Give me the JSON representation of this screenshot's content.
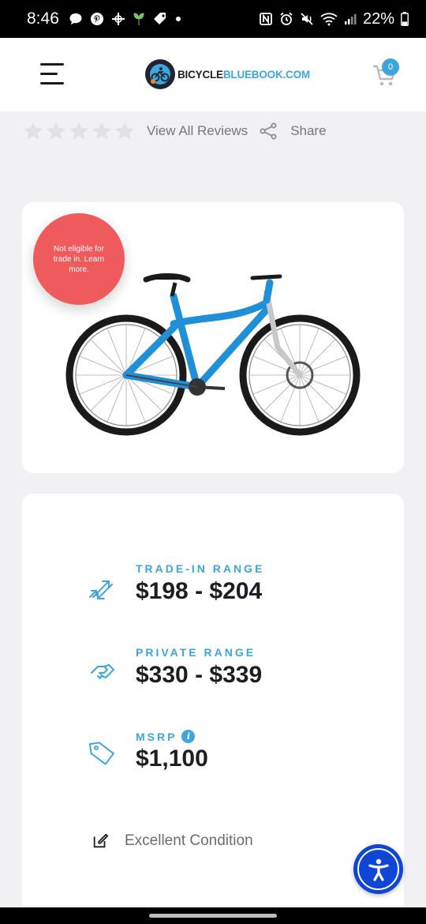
{
  "status_bar": {
    "time": "8:46",
    "battery": "22%",
    "left_icons": [
      "chat-icon",
      "pinterest-icon",
      "game-controller-icon",
      "plant-icon",
      "tag-icon",
      "dot-icon"
    ],
    "right_icons": [
      "nfc-icon",
      "alarm-icon",
      "mute-icon",
      "wifi-icon",
      "signal-icon",
      "battery-icon"
    ]
  },
  "header": {
    "logo_text_main": "BICYCLE",
    "logo_text_accent": "BLUEBOOK.COM",
    "cart_count": "0",
    "brand_color": "#3ca6dd"
  },
  "reviews": {
    "star_count": 5,
    "rating": 0,
    "view_all_label": "View All Reviews",
    "share_label": "Share"
  },
  "image_card": {
    "badge_text": "Not eligible for trade in. Learn more.",
    "badge_color": "#ef5a5d",
    "bike_color": "#1f8fd8"
  },
  "prices": {
    "trade_in": {
      "label": "TRADE-IN RANGE",
      "value": "$198 - $204",
      "icon": "trade-arrows-icon"
    },
    "private": {
      "label": "PRIVATE RANGE",
      "value": "$330 - $339",
      "icon": "handshake-icon"
    },
    "msrp": {
      "label": "MSRP",
      "value": "$1,100",
      "icon": "price-tag-icon",
      "info_glyph": "i"
    }
  },
  "condition": {
    "label": "Excellent Condition",
    "icon": "edit-icon"
  },
  "accessibility": {
    "icon": "accessibility-icon",
    "color": "#1046d6"
  }
}
